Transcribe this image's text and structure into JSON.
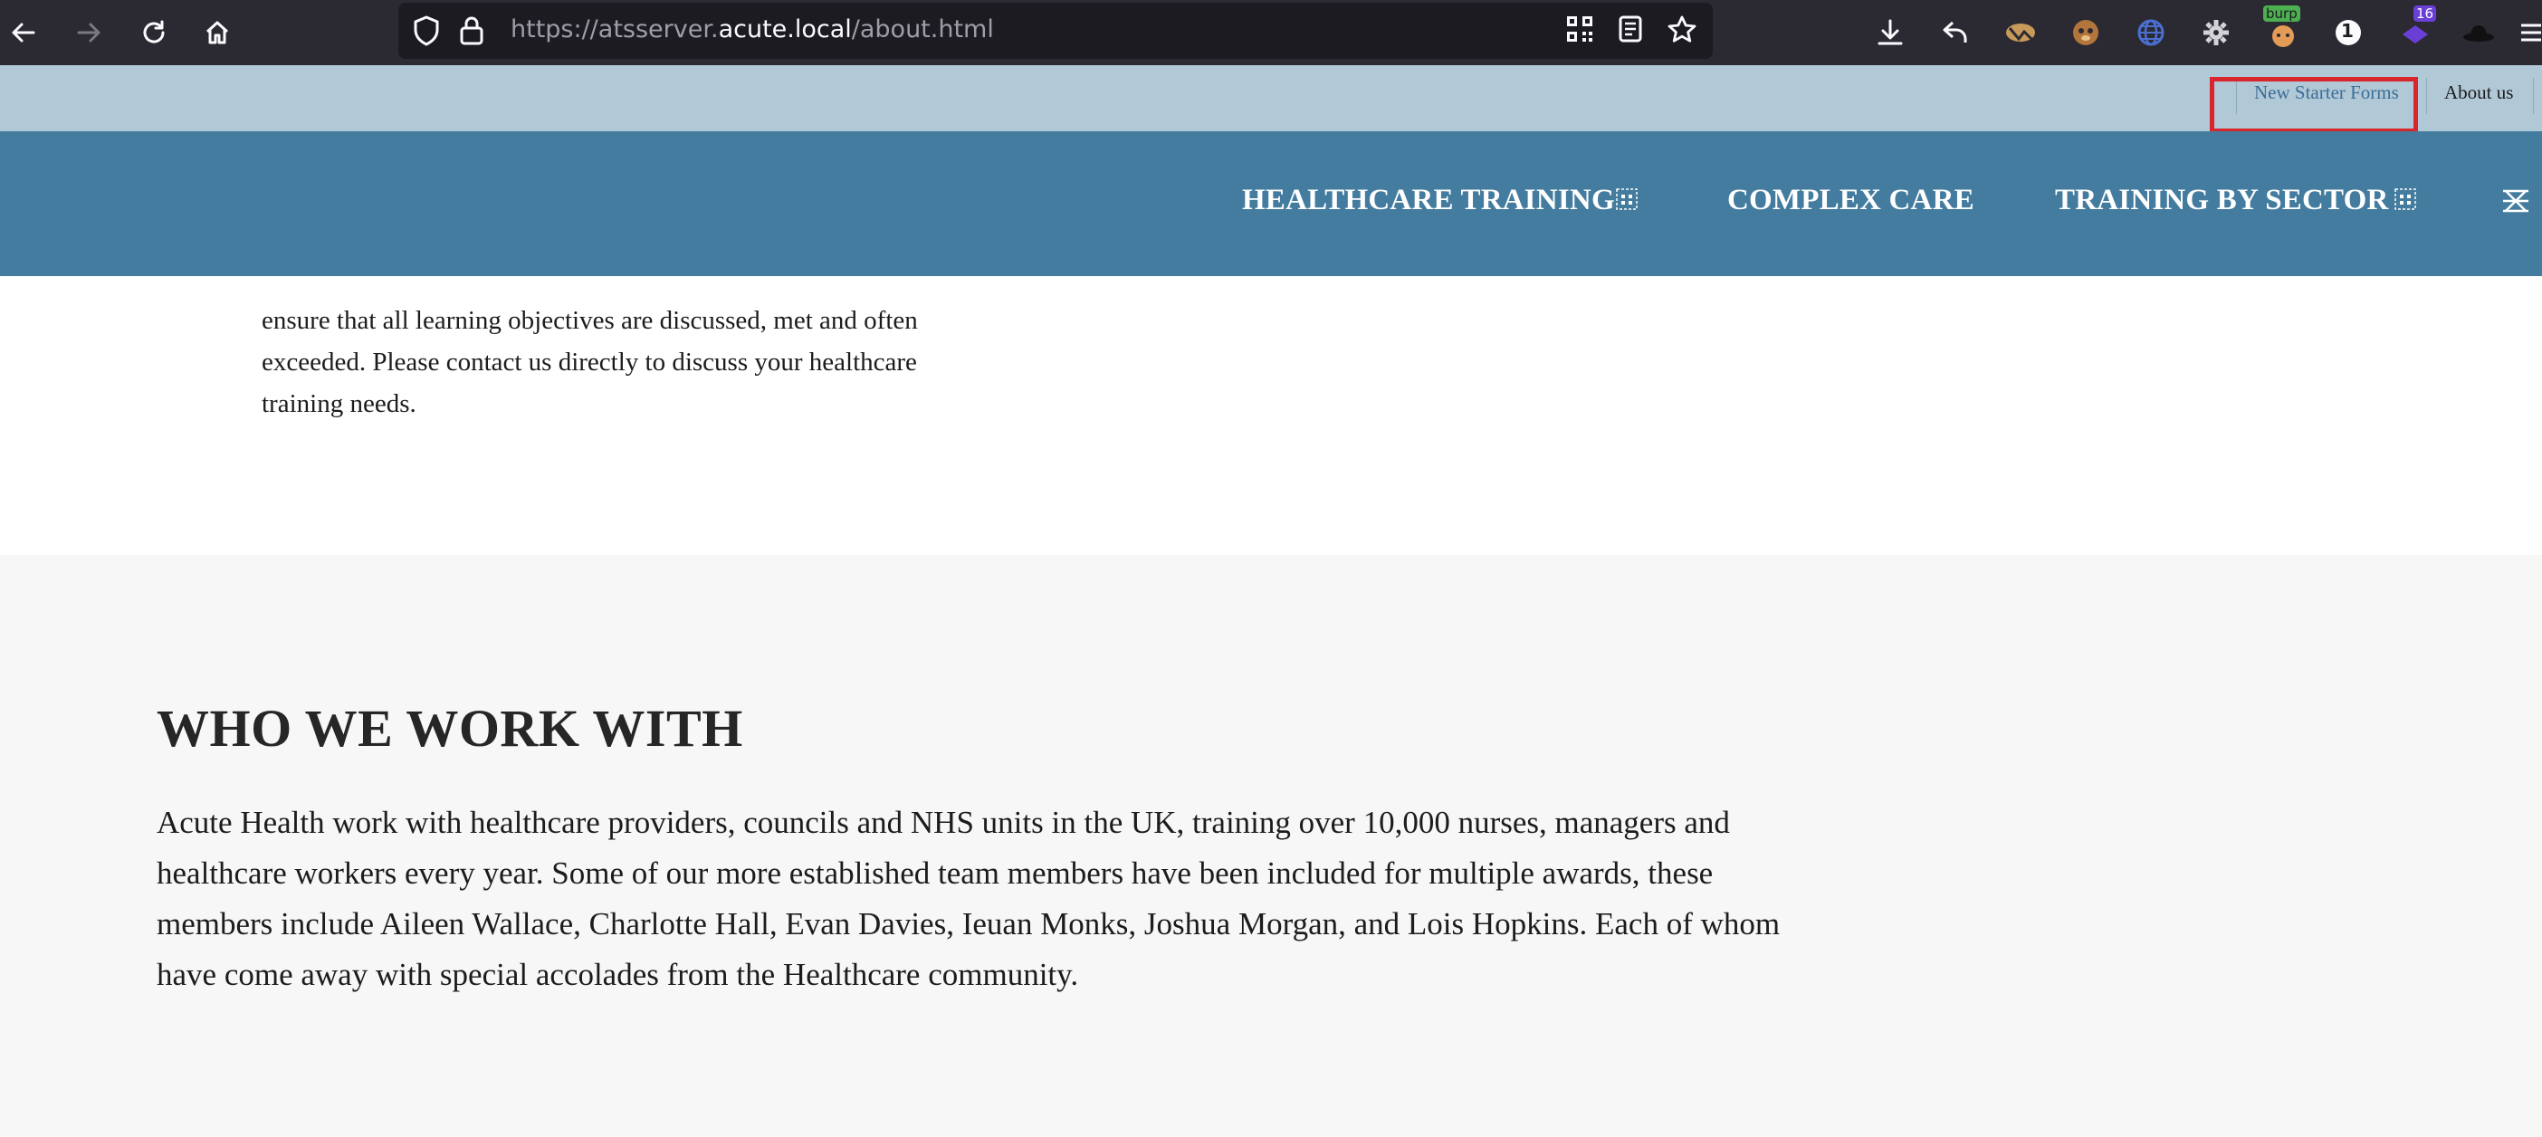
{
  "browser": {
    "url_prefix": "https://atsserver.",
    "url_host": "acute.local",
    "url_path": "/about.html",
    "extension_badges": {
      "burp": "burp",
      "onepassword": "1",
      "counter": "16"
    }
  },
  "site": {
    "top_links": {
      "new_starter_forms": "New Starter Forms",
      "about_us": "About us"
    },
    "main_nav": {
      "healthcare_training": "HEALTHCARE TRAINING",
      "complex_care": "COMPLEX CARE",
      "training_by_sector": "TRAINING BY SECTOR"
    },
    "intro_text": "ensure that all learning objectives are discussed, met and often exceeded. Please contact us directly to discuss your healthcare training needs.",
    "who_we_work_with": {
      "title": "WHO WE WORK WITH",
      "body": "Acute Health work with healthcare providers, councils and NHS units in the UK, training over 10,000 nurses, managers and healthcare workers every year. Some of our more established team members have been included for multiple awards, these members include Aileen Wallace, Charlotte Hall, Evan Davies, Ieuan Monks, Joshua Morgan, and Lois Hopkins. Each of whom have come away with special accolades from the Healthcare community."
    }
  },
  "colors": {
    "chrome_bg": "#2b2a33",
    "topbar_bg": "#b1c8d6",
    "mainnav_bg": "#437c9f",
    "highlight_box": "#d8262c",
    "section_grey": "#f7f7f7"
  }
}
